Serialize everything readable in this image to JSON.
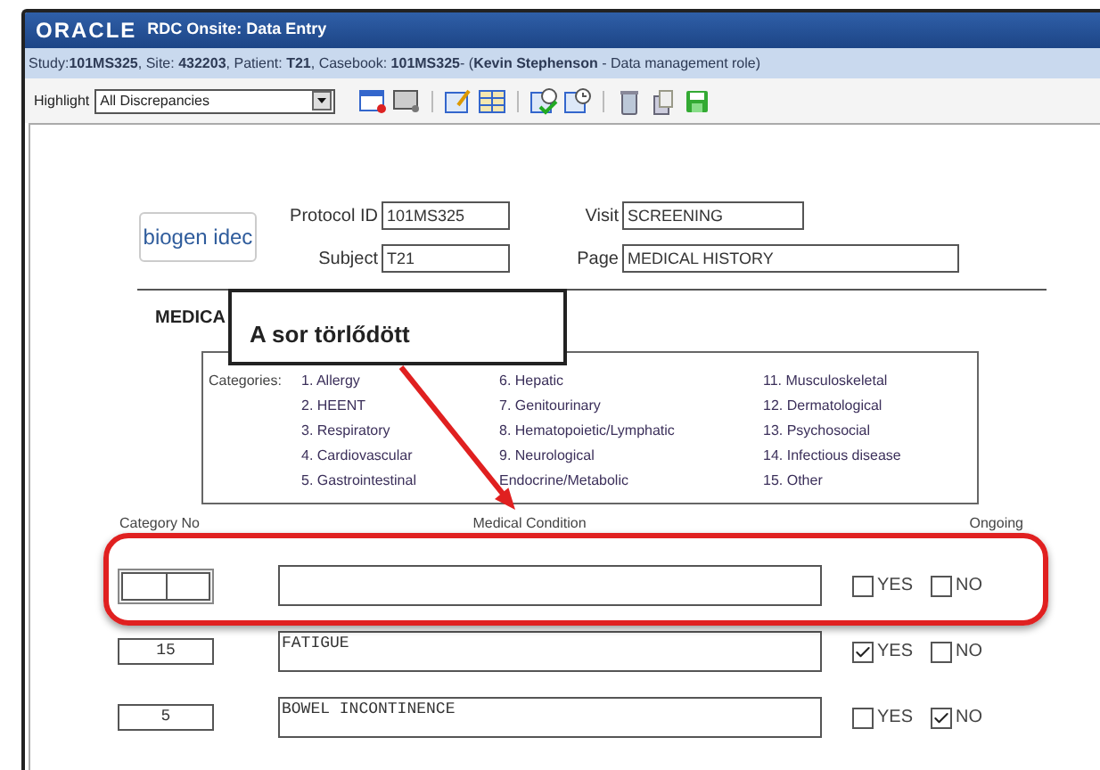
{
  "window": {
    "logo": "ORACLE",
    "title": "RDC Onsite: Data Entry"
  },
  "info_bar": "Study:**101MS325**, Site: **432203**, Patient: **T21**, Casebook: **101MS325**- (**Kevin Stephenson** - Data management role)",
  "toolbar": {
    "highlight_label": "Highlight",
    "highlight_value": "All Discrepancies"
  },
  "header": {
    "logo": "biogen idec",
    "fields": [
      {
        "label": "Protocol ID",
        "value": "101MS325"
      },
      {
        "label": "Visit",
        "value": "SCREENING"
      },
      {
        "label": "Subject",
        "value": "T21"
      },
      {
        "label": "Page",
        "value": "MEDICAL HISTORY"
      }
    ]
  },
  "section_title": "MEDICA",
  "categories": {
    "label": "Categories:",
    "columns": [
      [
        "1. Allergy",
        "2. HEENT",
        "3. Respiratory",
        "4. Cardiovascular",
        "5. Gastrointestinal"
      ],
      [
        "6. Hepatic",
        "7. Genitourinary",
        "8. Hematopoietic/Lymphatic",
        "9. Neurological",
        "Endocrine/Metabolic"
      ],
      [
        "11. Musculoskeletal",
        "12. Dermatological",
        "13. Psychosocial",
        "14. Infectious disease",
        "15. Other"
      ]
    ]
  },
  "columns": [
    "Category No",
    "Medical Condition",
    "Ongoing"
  ],
  "rows": [
    {
      "kind": "new",
      "category": "",
      "condition": "",
      "ongoing": [
        {
          "label": "YES",
          "checked": false
        },
        {
          "label": "NO",
          "checked": false
        }
      ]
    },
    {
      "kind": "entered",
      "category": "15",
      "condition": "FATIGUE",
      "ongoing": [
        {
          "label": "YES",
          "checked": true
        },
        {
          "label": "NO",
          "checked": false
        }
      ]
    },
    {
      "kind": "entered",
      "category": "5",
      "condition": "BOWEL INCONTINENCE",
      "ongoing": [
        {
          "label": "YES",
          "checked": false
        },
        {
          "label": "NO",
          "checked": true
        }
      ]
    }
  ],
  "annotation": {
    "callout": "A sor törlődött"
  }
}
